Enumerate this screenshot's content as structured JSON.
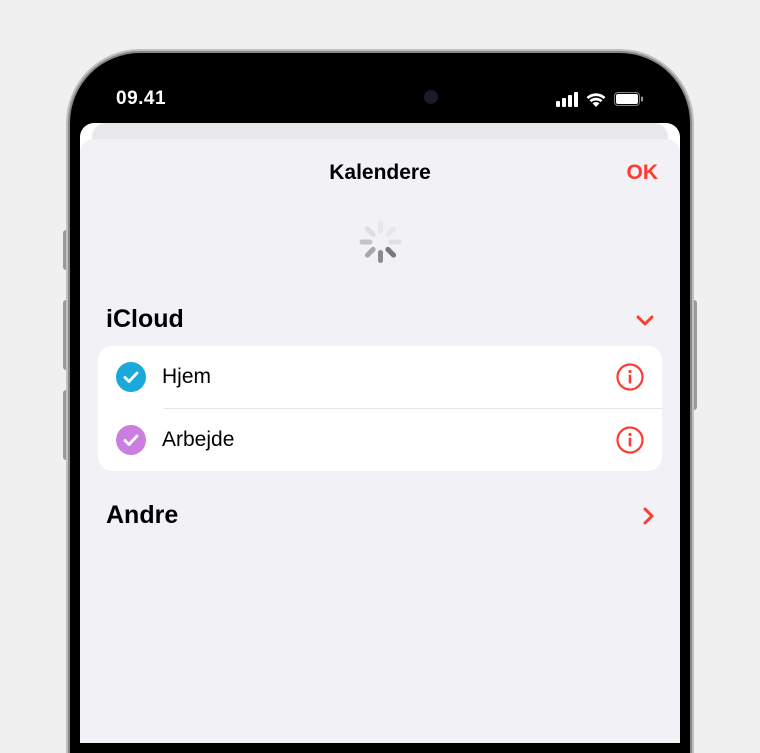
{
  "status_bar": {
    "time": "09.41"
  },
  "sheet": {
    "title": "Kalendere",
    "ok_label": "OK"
  },
  "colors": {
    "accent": "#ff3b30",
    "blue_cal": "#1aa9da",
    "purple_cal": "#c97ee0"
  },
  "sections": [
    {
      "title": "iCloud",
      "expanded": true,
      "items": [
        {
          "label": "Hjem",
          "color": "blue"
        },
        {
          "label": "Arbejde",
          "color": "purple"
        }
      ]
    },
    {
      "title": "Andre",
      "expanded": false,
      "items": []
    }
  ]
}
